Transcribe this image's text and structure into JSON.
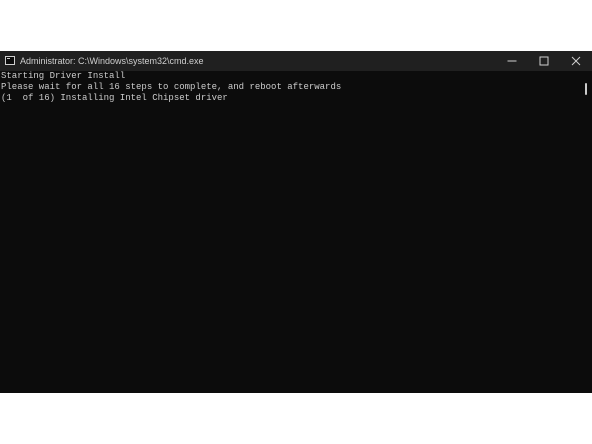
{
  "window": {
    "title": "Administrator: C:\\Windows\\system32\\cmd.exe",
    "icon": "cmd-icon",
    "controls": {
      "minimize": "minimize-icon",
      "maximize": "maximize-icon",
      "close": "close-icon"
    }
  },
  "console": {
    "lines": [
      "Starting Driver Install",
      "Please wait for all 16 steps to complete, and reboot afterwards",
      "(1  of 16) Installing Intel Chipset driver"
    ]
  },
  "colors": {
    "background": "#0c0c0c",
    "titlebar": "#202020",
    "text": "#cccccc"
  }
}
